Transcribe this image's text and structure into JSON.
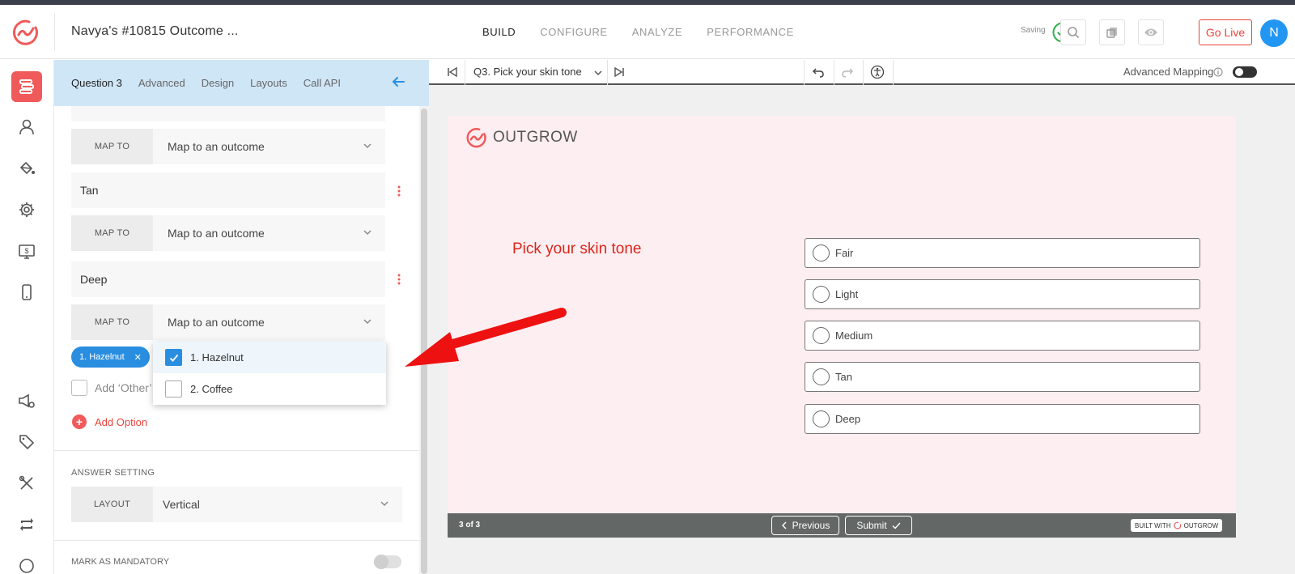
{
  "header": {
    "project_title": "Navya's #10815 Outcome ...",
    "nav": [
      "BUILD",
      "CONFIGURE",
      "ANALYZE",
      "PERFORMANCE"
    ],
    "saving_label": "Saving",
    "go_live_label": "Go Live",
    "avatar_initial": "N"
  },
  "panel": {
    "tabs": [
      "Question 3",
      "Advanced",
      "Design",
      "Layouts",
      "Call API"
    ],
    "options": [
      {
        "label": "Tan"
      },
      {
        "label": "Deep"
      }
    ],
    "map_to_label": "MAP TO",
    "map_placeholder": "Map to an outcome",
    "chip_label": "1. Hazelnut",
    "add_other_label": "Add ‘Other’",
    "add_option_label": "Add Option",
    "answer_setting_label": "ANSWER SETTING",
    "layout_label": "LAYOUT",
    "layout_value": "Vertical",
    "mandatory_label": "MARK AS MANDATORY"
  },
  "dropdown": {
    "items": [
      {
        "label": "1. Hazelnut",
        "checked": true
      },
      {
        "label": "2. Coffee",
        "checked": false
      }
    ]
  },
  "toolbar": {
    "question_select": "Q3. Pick your skin tone",
    "advanced_mapping_label": "Advanced Mapping"
  },
  "preview": {
    "logo_text": "OUTGROW",
    "question": "Pick your skin tone",
    "choices": [
      "Fair",
      "Light",
      "Medium",
      "Tan",
      "Deep"
    ],
    "page_count": "3 of 3",
    "previous_label": "Previous",
    "submit_label": "Submit",
    "built_with_label": "BUILT WITH",
    "built_with_brand": "OUTGROW"
  },
  "colors": {
    "brand_red": "#f05a5a",
    "accent_blue": "#2a8ee0",
    "annotation_arrow": "#ee1111"
  }
}
